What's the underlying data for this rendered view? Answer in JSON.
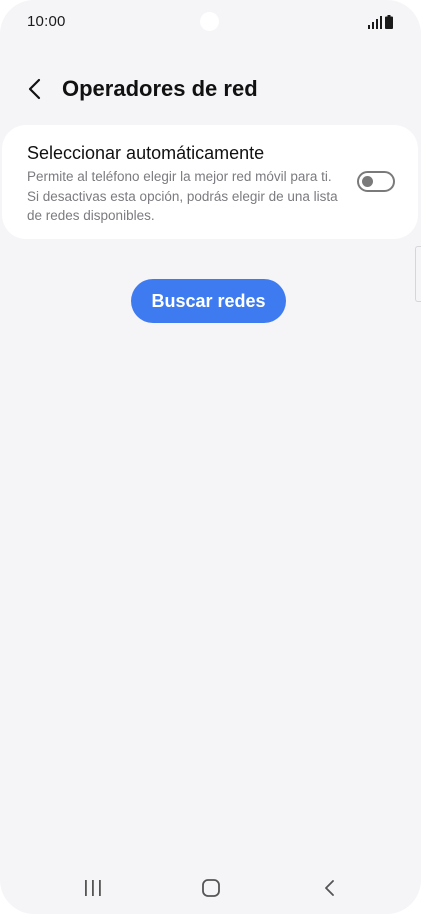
{
  "status_bar": {
    "time": "10:00",
    "signal_icon": "signal-icon",
    "battery_icon": "battery-icon"
  },
  "header": {
    "back_icon": "chevron-left-icon",
    "title": "Operadores de red"
  },
  "auto_select": {
    "title": "Seleccionar automáticamente",
    "description": "Permite al teléfono elegir la mejor red móvil para ti. Si desactivas esta opción, podrás elegir de una lista de redes disponibles.",
    "enabled": false
  },
  "search_button": {
    "label": "Buscar redes"
  },
  "nav_bar": {
    "recents_icon": "recents-icon",
    "home_icon": "home-icon",
    "back_icon": "back-icon"
  },
  "colors": {
    "accent": "#3e7bf0",
    "background": "#f5f5f8",
    "card": "#ffffff",
    "toggle_off": "#7a7a7a"
  }
}
